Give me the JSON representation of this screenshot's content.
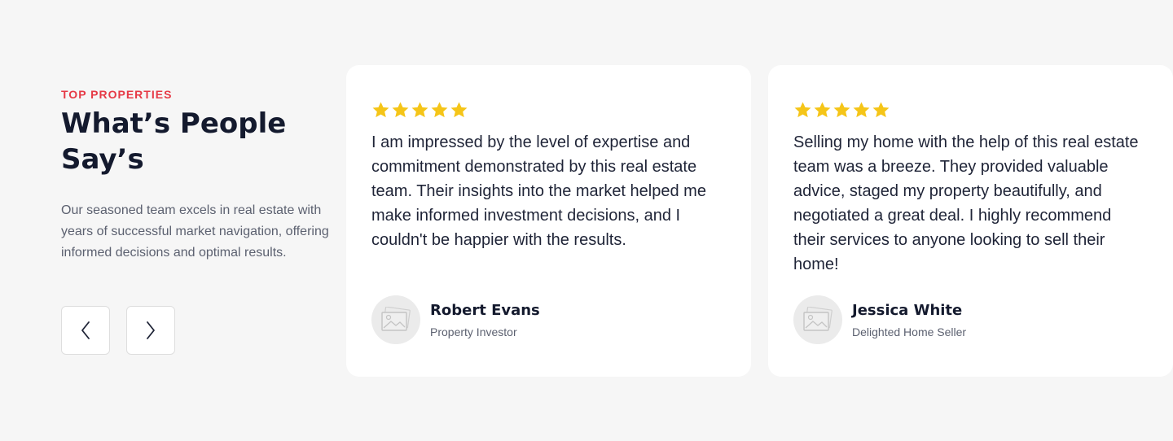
{
  "intro": {
    "eyebrow": "TOP PROPERTIES",
    "heading": "What’s People Say’s",
    "description": "Our seasoned team excels in real estate with years of successful market navigation, offering informed decisions and optimal results."
  },
  "navigation": {
    "prev_icon": "chevron-left-icon",
    "next_icon": "chevron-right-icon"
  },
  "testimonials": [
    {
      "rating": 5,
      "quote": "I am impressed by the level of expertise and commitment demonstrated by this real estate team. Their insights into the market helped me make informed investment decisions, and I couldn't be happier with the results.",
      "name": "Robert Evans",
      "role": "Property Investor",
      "avatar_icon": "image-placeholder-icon"
    },
    {
      "rating": 5,
      "quote": "Selling my home with the help of this real estate team was a breeze. They provided valuable advice, staged my property beautifully, and negotiated a great deal. I highly recommend their services to anyone looking to sell their home!",
      "name": "Jessica White",
      "role": "Delighted Home Seller",
      "avatar_icon": "image-placeholder-icon"
    }
  ],
  "colors": {
    "background": "#f6f6f6",
    "accent": "#e63a46",
    "star": "#f5c518",
    "heading": "#141a2e",
    "body_text": "#5c6170"
  }
}
